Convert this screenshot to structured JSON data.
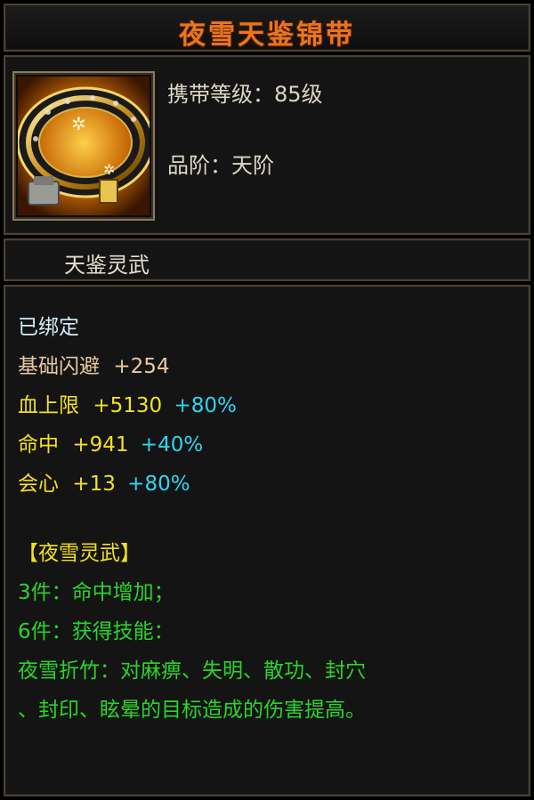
{
  "item": {
    "name": "夜雪天鉴锦带",
    "carry_level": "携带等级：85级",
    "grade": "品阶：天阶",
    "set_name": "天鉴灵武",
    "bound": "已绑定"
  },
  "stats": [
    {
      "name": "基础闪避",
      "value": "+254",
      "pct": "",
      "color": "#e8c9a0"
    },
    {
      "name": "血上限",
      "value": "+5130",
      "pct": "+80%",
      "color": "#f3e021"
    },
    {
      "name": "命中",
      "value": "+941",
      "pct": "+40%",
      "color": "#f3e021"
    },
    {
      "name": "会心",
      "value": "+13",
      "pct": "+80%",
      "color": "#f3e021"
    }
  ],
  "set": {
    "title": "【夜雪灵武】",
    "bonus_3": "3件：命中增加；",
    "bonus_6": "6件：获得技能：",
    "skill_line1": "夜雪折竹：对麻痹、失明、散功、封穴",
    "skill_line2": "、封印、眩晕的目标造成的伤害提高。"
  },
  "colors": {
    "title": "#e8761e",
    "bound": "#d4ecf8",
    "percent": "#2fd4f0",
    "set_title": "#f3e021",
    "set_text": "#2bd42b"
  },
  "icon": "golden-belt-icon"
}
